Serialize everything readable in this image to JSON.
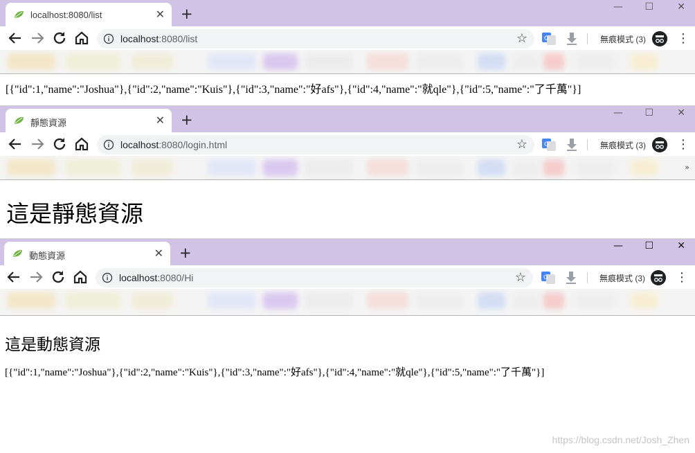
{
  "windows": [
    {
      "tab_title": "localhost:8080/list",
      "url_host": "localhost",
      "url_rest": ":8080/list",
      "json_text": "[{\"id\":1,\"name\":\"Joshua\"},{\"id\":2,\"name\":\"Kuis\"},{\"id\":3,\"name\":\"好afs\"},{\"id\":4,\"name\":\"就qle\"},{\"id\":5,\"name\":\"了千萬\"}]"
    },
    {
      "tab_title": "靜態資源",
      "url_host": "localhost",
      "url_rest": ":8080/login.html",
      "heading": "這是靜態資源"
    },
    {
      "tab_title": "動態資源",
      "url_host": "localhost",
      "url_rest": ":8080/Hi",
      "heading": "這是動態資源",
      "json_text": "[{\"id\":1,\"name\":\"Joshua\"},{\"id\":2,\"name\":\"Kuis\"},{\"id\":3,\"name\":\"好afs\"},{\"id\":4,\"name\":\"就qle\"},{\"id\":5,\"name\":\"了千萬\"}]"
    }
  ],
  "chrome": {
    "incognito_label": "無痕模式 (3)",
    "new_tab_glyph": "+",
    "close_tab_glyph": "✕",
    "star_glyph": "☆",
    "menu_glyph": "⋮",
    "minimize_glyph": "—",
    "maximize_glyph": "☐",
    "close_window_glyph": "✕",
    "bookmarks_overflow": "»",
    "tab_strip_color": "#d0c3e6",
    "omnibox_color": "#f1f3f4"
  },
  "icons": {
    "favicon": "spring-leaf-icon",
    "back": "arrow-left-icon",
    "forward": "arrow-right-icon",
    "reload": "reload-icon",
    "home": "home-icon",
    "info": "info-icon",
    "translate": "google-translate-icon",
    "download": "download-icon",
    "incognito": "incognito-icon"
  },
  "watermark": "https://blog.csdn.net/Josh_Zhen"
}
